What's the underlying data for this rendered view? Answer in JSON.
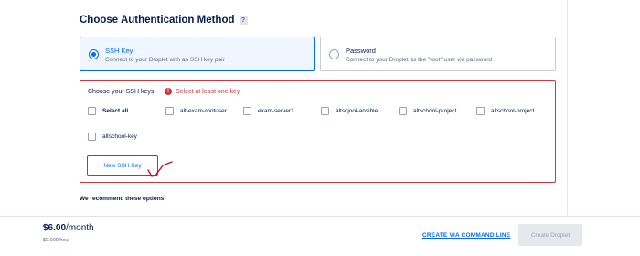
{
  "auth": {
    "title": "Choose Authentication Method",
    "help": "?",
    "options": [
      {
        "title": "SSH Key",
        "description": "Connect to your Droplet with an SSH key pair",
        "selected": true
      },
      {
        "title": "Password",
        "description": "Connect to your Droplet as the \"root\" user via password",
        "selected": false
      }
    ]
  },
  "ssh_keys": {
    "label": "Choose your SSH keys",
    "error": "Select at least one key.",
    "select_all": "Select all",
    "keys": [
      "alt-exam-rootuser",
      "exam-server1",
      "altscjool-ansible",
      "altschool-project",
      "altschool-project",
      "altschool-key"
    ],
    "new_key_button": "New SSH Key"
  },
  "recommend": {
    "title": "We recommend these options"
  },
  "footer": {
    "price": "$6.00",
    "price_unit": "/month",
    "price_hourly": "$0.009/hour",
    "cli_link": "CREATE VIA COMMAND LINE",
    "create_button": "Create Droplet"
  },
  "colors": {
    "accent": "#0069ff",
    "error": "#d0353e",
    "text": "#031b4e",
    "annotation": "#c8102e"
  }
}
